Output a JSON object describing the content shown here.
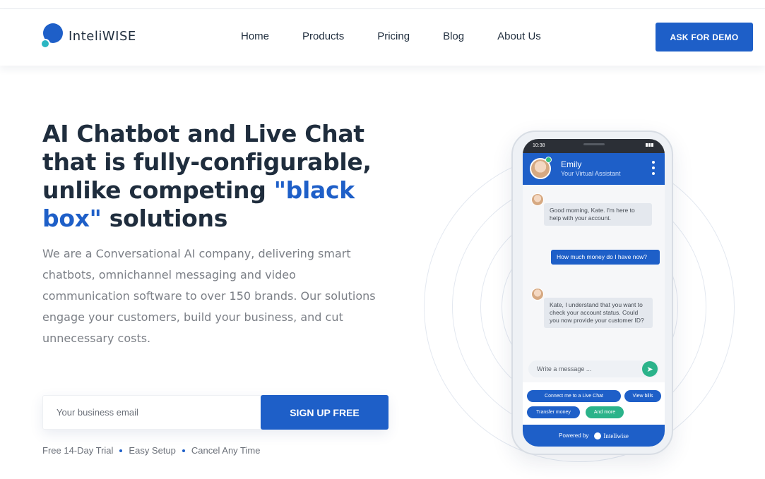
{
  "header": {
    "brand": "InteliWISE",
    "nav": [
      "Home",
      "Products",
      "Pricing",
      "Blog",
      "About Us"
    ],
    "cta_label": "ASK FOR DEMO"
  },
  "hero": {
    "headline_part1": "AI Chatbot and Live Chat that is fully-configurable, unlike competing ",
    "headline_highlight": "\"black box\"",
    "headline_part2": " solutions",
    "description": "We are a Conversational AI company, delivering smart chatbots, omnichannel messaging and video communication software to over 150 brands. Our solutions engage your customers, build your business, and cut unnecessary costs.",
    "email_placeholder": "Your business email",
    "signup_label": "SIGN UP FREE",
    "features": [
      "Free 14-Day Trial",
      "Easy Setup",
      "Cancel Any Time"
    ]
  },
  "phone": {
    "time": "10:38",
    "agent_name": "Emily",
    "agent_role": "Your Virtual Assistant",
    "messages": [
      {
        "from": "bot",
        "text": "Good morning, Kate. I'm here to help with your account."
      },
      {
        "from": "user",
        "text": "How much money do I have now?"
      },
      {
        "from": "bot",
        "text": "Kate, I understand that you want to check your account status. Could you now provide your customer ID?"
      }
    ],
    "input_placeholder": "Write a message ...",
    "quick_replies": [
      "Connect me to a Live Chat",
      "View bills",
      "Transfer money",
      "And more"
    ],
    "powered_label": "Powered by",
    "powered_brand": "Inteliwise"
  },
  "colors": {
    "primary": "#1e5fc8",
    "accent_teal": "#2bb38a",
    "text_dark": "#1f2d3d",
    "text_muted": "#7b7f86"
  }
}
